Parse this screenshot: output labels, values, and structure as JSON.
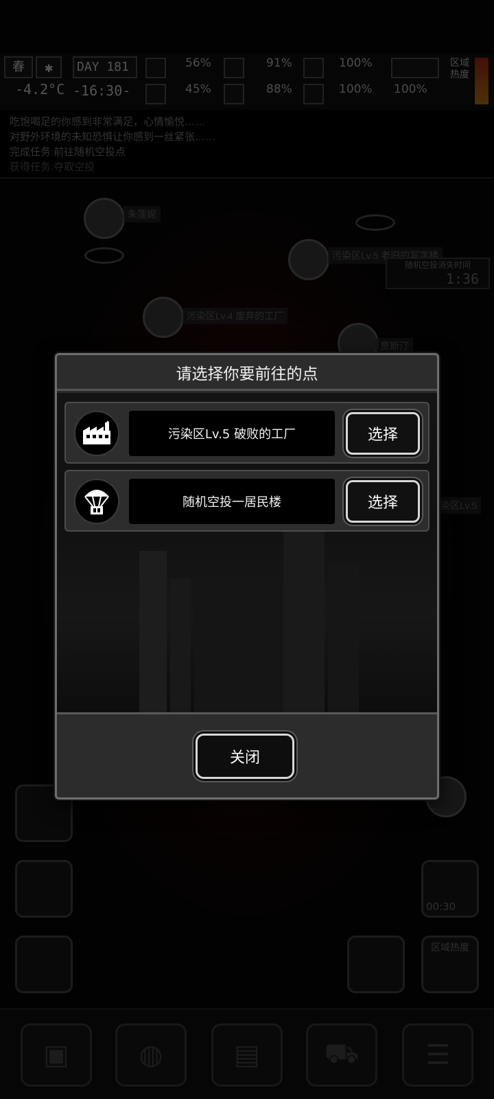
{
  "status_bar": {
    "season": "春",
    "temperature": "-4.2°C",
    "day": "DAY 181",
    "time": "-16:30-",
    "stats_top": [
      "56%",
      "91%",
      "100%"
    ],
    "stats_bottom": [
      "45%",
      "88%",
      "100%",
      "100%"
    ],
    "zone_heat_label": "区域热度"
  },
  "message_log": [
    "吃饱喝足的你感到非常满足，心情愉悦……",
    "对野外环境的未知恐惧让你感到一丝紧张……",
    "完成任务:前往随机空投点",
    "获得任务:夺取空投"
  ],
  "map": {
    "labels": [
      "朱莲妮",
      "污染区Lv.5 老旧的写字楼",
      "污染区Lv.4 废弃的工厂",
      "贾斯汀",
      "染区Lv.5"
    ],
    "airdrop_timer_label": "随机空投消失时间",
    "airdrop_timer": "1:36",
    "radar_timer": "00:30",
    "zone_heat_button": "区域热度"
  },
  "dialog": {
    "title": "请选择你要前往的点",
    "options": [
      {
        "icon": "factory-icon",
        "label": "污染区Lv.5 破败的工厂",
        "button": "选择"
      },
      {
        "icon": "parachute-icon",
        "label": "随机空投一居民楼",
        "button": "选择"
      }
    ],
    "close_button": "关闭"
  },
  "icons": [
    "backpack-icon",
    "brain-icon",
    "notebook-icon",
    "cart-icon",
    "menu-icon",
    "jeep-icon",
    "tap-icon",
    "radar-icon",
    "map-folder-icon"
  ]
}
